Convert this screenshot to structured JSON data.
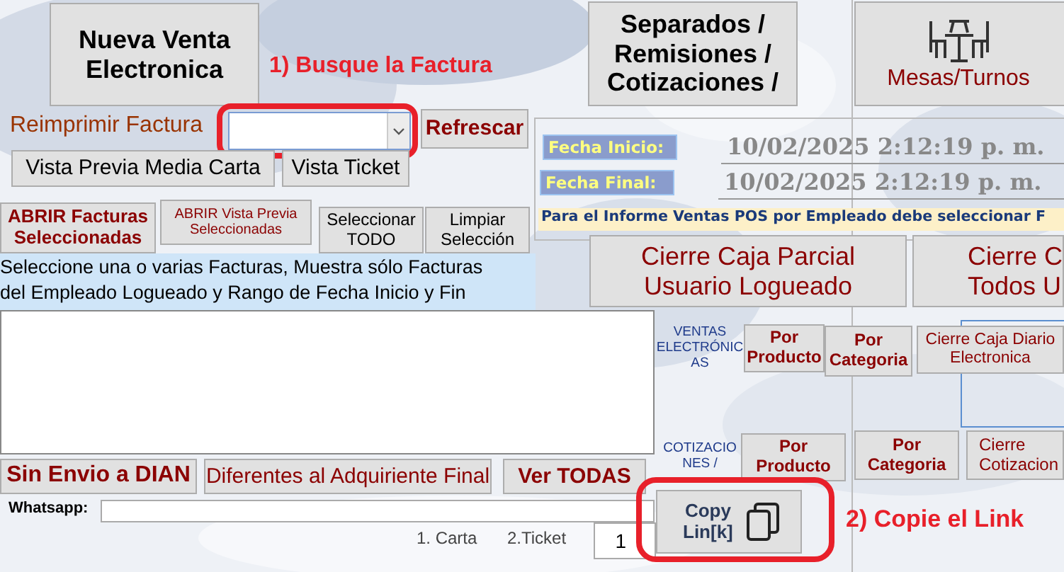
{
  "new_sale_button": {
    "lines": [
      "Nueva Venta",
      "Electronica"
    ]
  },
  "annotations": [
    {
      "text": "1) Busque la Factura"
    },
    {
      "text": "2) Copie el Link"
    }
  ],
  "quotes_button": {
    "lines": [
      "Separados /",
      "Remisiones /",
      "Cotizaciones /"
    ]
  },
  "tables_button": {
    "label": "Mesas/Turnos"
  },
  "reprint": {
    "label": "Reimprimir Factura",
    "refresh_button": "Refrescar",
    "preview_half_letter_button": "Vista Previa Media Carta",
    "preview_ticket_button": "Vista Ticket"
  },
  "selection_buttons": [
    {
      "lines": [
        "ABRIR Facturas",
        "Seleccionadas"
      ]
    },
    {
      "lines": [
        "ABRIR Vista Previa",
        "Seleccionadas"
      ]
    },
    {
      "lines": [
        "Seleccionar",
        "TODO"
      ]
    },
    {
      "lines": [
        "Limpiar",
        "Selección"
      ]
    }
  ],
  "info_text": [
    "Seleccione una o varias Facturas, Muestra sólo Facturas",
    "del Empleado Logueado y Rango de Fecha Inicio y Fin"
  ],
  "date_range": {
    "start_label": "Fecha Inicio:",
    "start_value": "10/02/2025 2:12:19 p. m.",
    "end_label": "Fecha Final:",
    "end_value": "10/02/2025 2:12:19 p. m."
  },
  "notice": "Para el Informe Ventas POS por Empleado debe seleccionar F",
  "cash_close_buttons": [
    {
      "lines": [
        "Cierre Caja Parcial",
        "Usuario Logueado"
      ]
    },
    {
      "lines": [
        "Cierre C",
        "Todos U"
      ]
    }
  ],
  "report_rows": [
    {
      "label_lines": [
        "VENTAS",
        "ELECTRÓNIC",
        "AS"
      ],
      "buttons": [
        {
          "lines": [
            "Por",
            "Producto"
          ]
        },
        {
          "lines": [
            "Por",
            "Categoria"
          ]
        },
        {
          "lines": [
            "Cierre Caja Diario",
            "Electronica"
          ]
        }
      ]
    },
    {
      "label_lines": [
        "COTIZACIO",
        "NES /"
      ],
      "buttons": [
        {
          "lines": [
            "Por",
            "Producto"
          ]
        },
        {
          "lines": [
            "Por",
            "Categoria"
          ]
        },
        {
          "lines": [
            "Cierre",
            "Cotizacion"
          ]
        }
      ]
    }
  ],
  "filter_buttons": [
    "Sin Envio a DIAN",
    "Diferentes al Adquiriente Final",
    "Ver TODAS"
  ],
  "whatsapp": {
    "label": "Whatsapp:"
  },
  "print_format": {
    "options": [
      "1. Carta",
      "2.Ticket"
    ],
    "value": "1"
  },
  "copy_link_button": {
    "lines": [
      "Copy",
      "Lin[k]"
    ]
  }
}
